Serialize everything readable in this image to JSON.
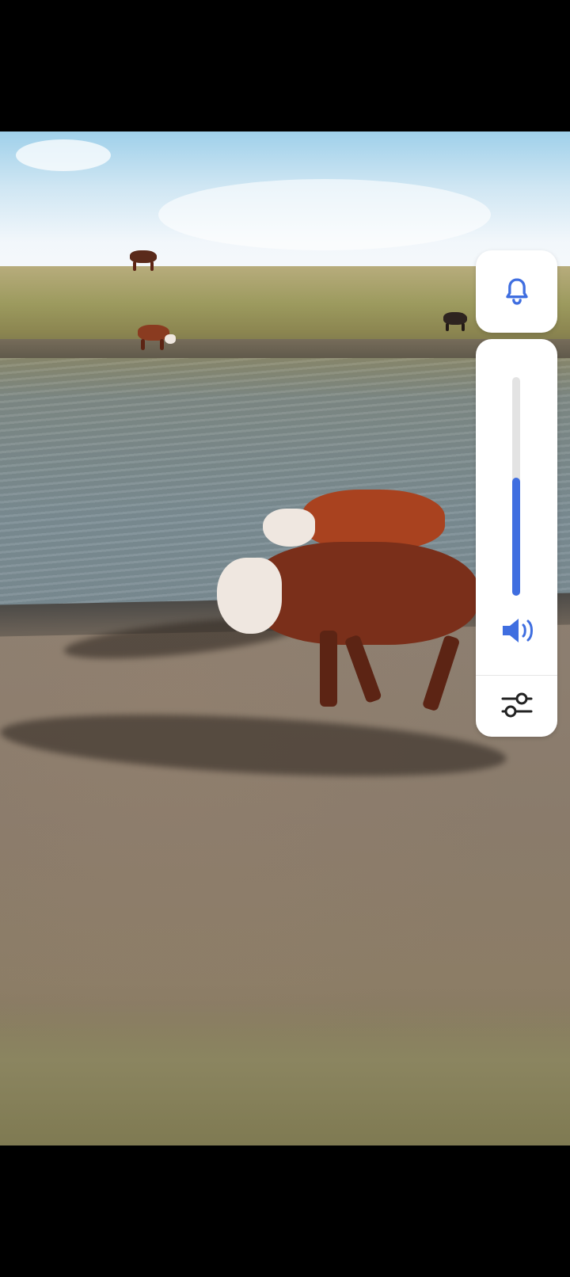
{
  "video": {
    "scene": "cows-at-pond"
  },
  "volume_panel": {
    "ringer_icon": "bell-icon",
    "volume_level_fraction": 0.54,
    "speaker_icon": "speaker-volume-icon",
    "settings_icon": "sliders-settings-icon",
    "accent_color": "#3f6ee0"
  }
}
